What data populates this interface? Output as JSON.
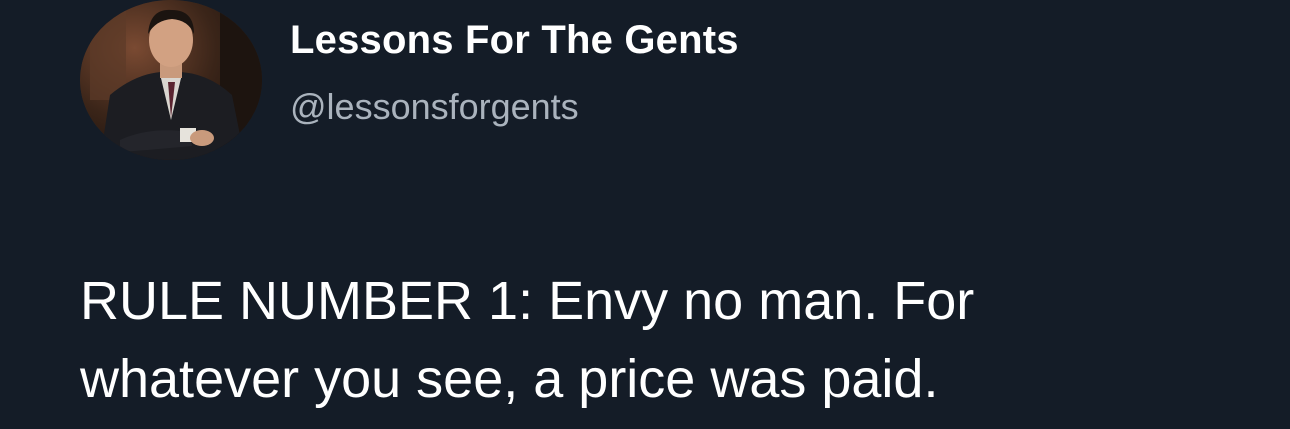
{
  "author": {
    "display_name": "Lessons For The Gents",
    "handle": "@lessonsforgents",
    "avatar_icon": "profile-photo-man-in-suit"
  },
  "tweet": {
    "text": "RULE NUMBER 1: Envy no man. For\nwhatever you see, a price was paid."
  },
  "colors": {
    "background": "#141c27",
    "name": "#ffffff",
    "handle": "#aab3bd",
    "text": "#ffffff"
  }
}
